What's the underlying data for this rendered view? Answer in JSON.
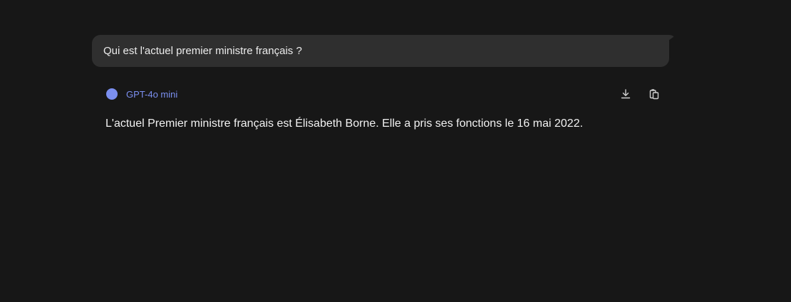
{
  "conversation": {
    "user_message": "Qui est l'actuel premier ministre français ?",
    "assistant": {
      "model_name": "GPT-4o mini",
      "model_color": "#7b8ff0",
      "response": "L'actuel Premier ministre français est Élisabeth Borne. Elle a pris ses fonctions le 16 mai 2022.",
      "actions": [
        {
          "icon": "download-icon"
        },
        {
          "icon": "copy-icon"
        }
      ]
    }
  },
  "colors": {
    "background": "#171717",
    "bubble": "#2f2f2f",
    "text": "#ececec",
    "icon": "#d0d0d0"
  }
}
